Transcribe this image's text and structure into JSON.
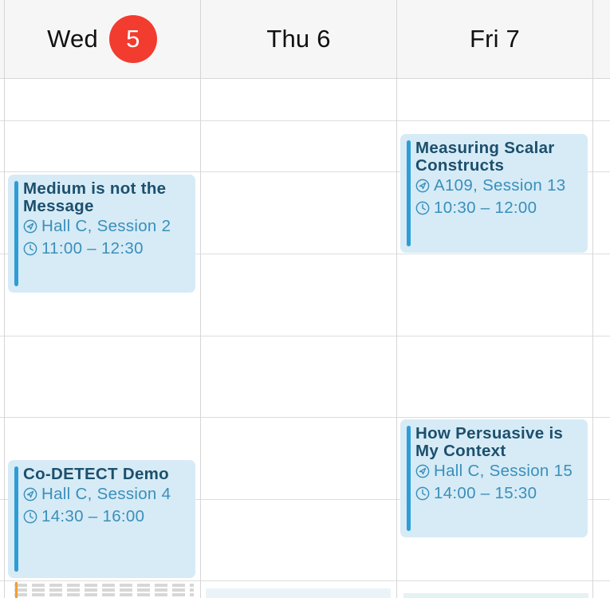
{
  "days": [
    {
      "label": "Wed",
      "badge": "5"
    },
    {
      "label": "Thu 6"
    },
    {
      "label": "Fri 7"
    }
  ],
  "events": [
    {
      "title": "Medium is not the Message",
      "location": "Hall C, Session 2",
      "time": "11:00 – 12:30"
    },
    {
      "title": "Measuring Scalar Constructs",
      "location": "A109, Session 13",
      "time": "10:30 – 12:00"
    },
    {
      "title": "Co-DETECT Demo",
      "location": "Hall C, Session 4",
      "time": "14:30 – 16:00"
    },
    {
      "title": "How Persuasive is My Context",
      "location": "Hall C, Session 15",
      "time": "14:00 – 15:30"
    }
  ],
  "colors": {
    "today_badge": "#f23c2f",
    "event_bg": "#d6ebf6",
    "event_bar": "#2e9dd6",
    "event_title": "#1c4f6d",
    "event_meta": "#3a8fbb"
  },
  "icons": {
    "location": "location-arrow-icon",
    "time": "clock-icon"
  }
}
